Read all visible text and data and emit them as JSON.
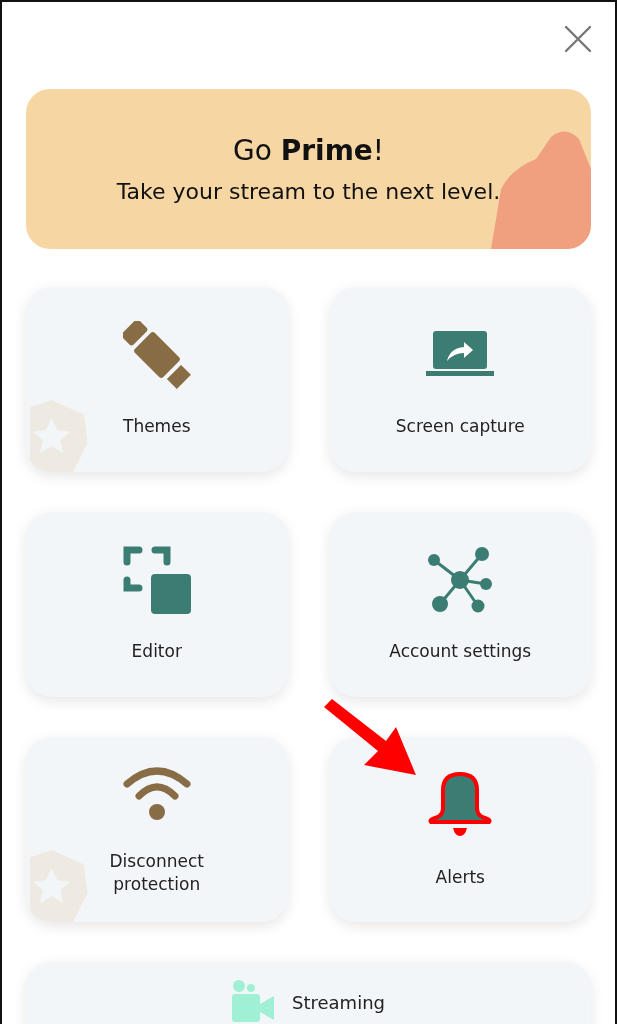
{
  "banner": {
    "title": "Go **Prime**!",
    "subtitle": "Take your stream to the next level."
  },
  "tiles": [
    {
      "label": "Themes",
      "premium": true,
      "highlighted": false
    },
    {
      "label": "Screen capture",
      "premium": false,
      "highlighted": false
    },
    {
      "label": "Editor",
      "premium": false,
      "highlighted": false
    },
    {
      "label": "Account settings",
      "premium": false,
      "highlighted": false
    },
    {
      "label": "Disconnect protection",
      "premium": true,
      "highlighted": false
    },
    {
      "label": "Alerts",
      "premium": false,
      "highlighted": true
    }
  ],
  "wide_tile": {
    "label": "Streaming"
  }
}
